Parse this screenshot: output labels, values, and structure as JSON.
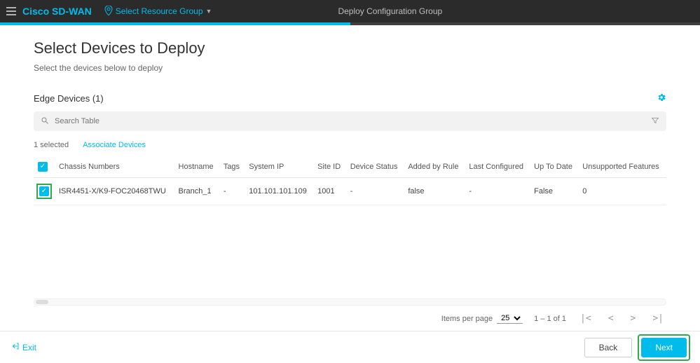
{
  "topbar": {
    "brand": "Cisco SD-WAN",
    "resource_group_label": "Select Resource Group",
    "deploy_title": "Deploy Configuration Group"
  },
  "page": {
    "title": "Select Devices to Deploy",
    "subtitle": "Select the devices below to deploy"
  },
  "section": {
    "title": "Edge Devices (1)"
  },
  "search": {
    "placeholder": "Search Table"
  },
  "list_meta": {
    "selected_text": "1 selected",
    "associate_label": "Associate Devices"
  },
  "table": {
    "headers": {
      "chassis": "Chassis Numbers",
      "hostname": "Hostname",
      "tags": "Tags",
      "system_ip": "System IP",
      "site_id": "Site ID",
      "device_status": "Device Status",
      "added_by_rule": "Added by Rule",
      "last_configured": "Last Configured",
      "up_to_date": "Up To Date",
      "unsupported": "Unsupported Features"
    },
    "rows": [
      {
        "chassis": "ISR4451-X/K9-FOC20468TWU",
        "hostname": "Branch_1",
        "tags": "-",
        "system_ip": "101.101.101.109",
        "site_id": "1001",
        "device_status": "-",
        "added_by_rule": "false",
        "last_configured": "-",
        "up_to_date": "False",
        "unsupported": "0"
      }
    ]
  },
  "pager": {
    "items_per_page_label": "Items per page",
    "items_per_page_value": "25",
    "range_text": "1 – 1 of 1"
  },
  "footer": {
    "exit_label": "Exit",
    "back_label": "Back",
    "next_label": "Next"
  }
}
